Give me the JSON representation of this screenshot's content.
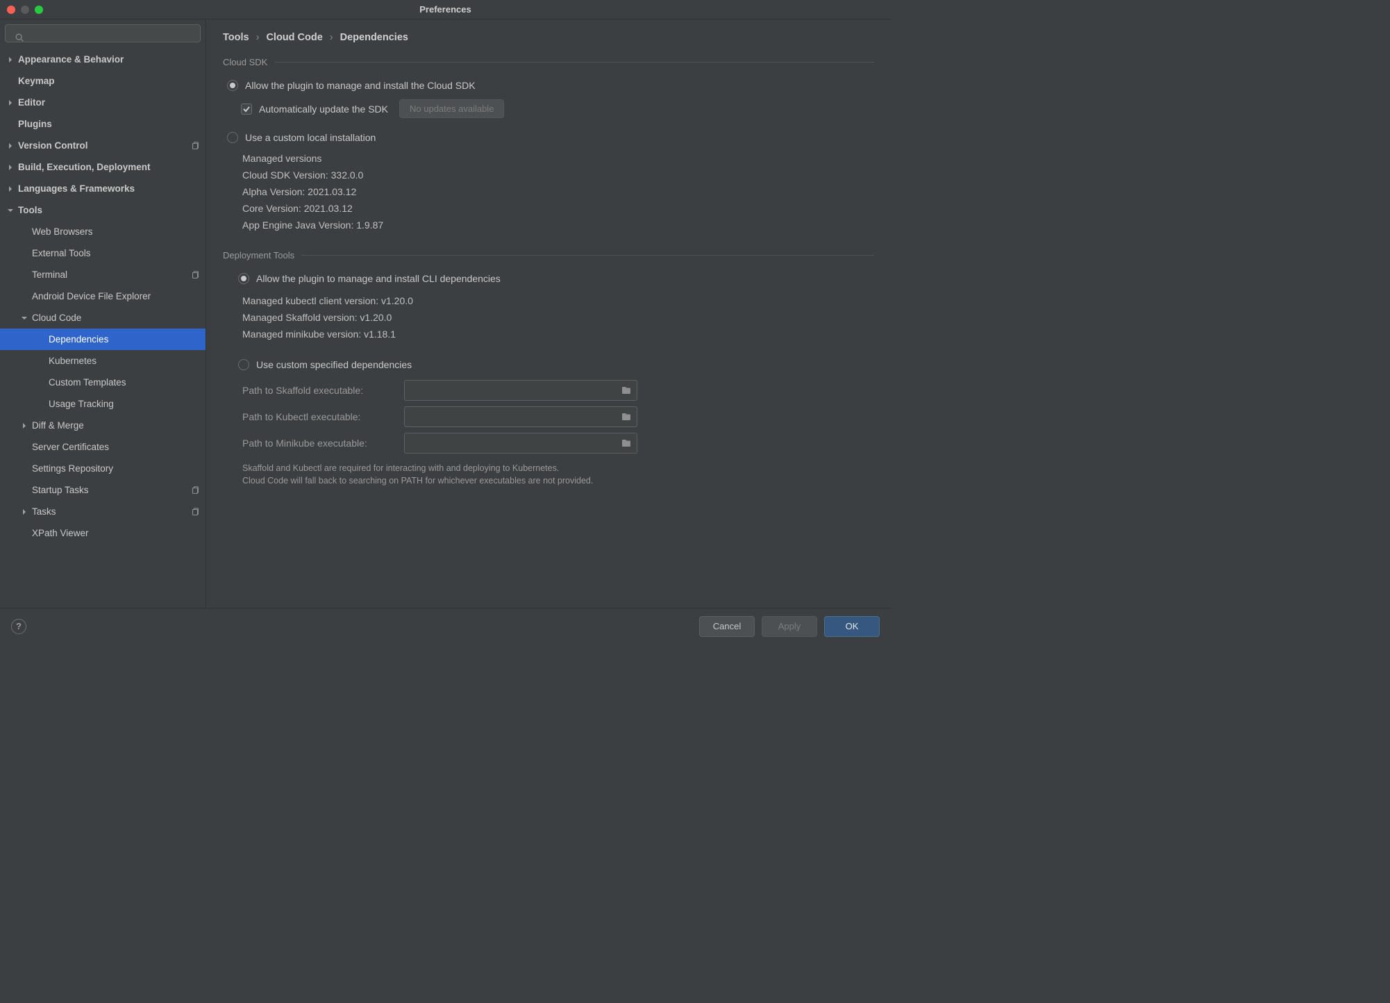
{
  "window": {
    "title": "Preferences"
  },
  "search": {
    "placeholder": ""
  },
  "sidebar": {
    "items": [
      {
        "label": "Appearance & Behavior",
        "top": true,
        "chev": true
      },
      {
        "label": "Keymap",
        "top": true
      },
      {
        "label": "Editor",
        "top": true,
        "chev": true
      },
      {
        "label": "Plugins",
        "top": true
      },
      {
        "label": "Version Control",
        "top": true,
        "chev": true,
        "copy": true
      },
      {
        "label": "Build, Execution, Deployment",
        "top": true,
        "chev": true
      },
      {
        "label": "Languages & Frameworks",
        "top": true,
        "chev": true
      },
      {
        "label": "Tools",
        "top": true,
        "chev": true,
        "expanded": true,
        "children": [
          {
            "label": "Web Browsers"
          },
          {
            "label": "External Tools"
          },
          {
            "label": "Terminal",
            "copy": true
          },
          {
            "label": "Android Device File Explorer"
          },
          {
            "label": "Cloud Code",
            "chev": true,
            "expanded": true,
            "children": [
              {
                "label": "Dependencies",
                "selected": true
              },
              {
                "label": "Kubernetes"
              },
              {
                "label": "Custom Templates"
              },
              {
                "label": "Usage Tracking"
              }
            ]
          },
          {
            "label": "Diff & Merge",
            "chev": true
          },
          {
            "label": "Server Certificates"
          },
          {
            "label": "Settings Repository"
          },
          {
            "label": "Startup Tasks",
            "copy": true
          },
          {
            "label": "Tasks",
            "chev": true,
            "copy": true
          },
          {
            "label": "XPath Viewer"
          }
        ]
      }
    ]
  },
  "breadcrumb": [
    "Tools",
    "Cloud Code",
    "Dependencies"
  ],
  "cloud_sdk": {
    "header": "Cloud SDK",
    "radio_managed": "Allow the plugin to manage and install the Cloud SDK",
    "auto_update": "Automatically update the SDK",
    "no_updates_btn": "No updates available",
    "radio_custom": "Use a custom local installation",
    "managed_versions_title": "Managed versions",
    "lines": [
      "Cloud SDK Version: 332.0.0",
      "Alpha Version: 2021.03.12",
      "Core Version: 2021.03.12",
      "App Engine Java Version: 1.9.87"
    ]
  },
  "deploy": {
    "header": "Deployment Tools",
    "radio_managed": "Allow the plugin to manage and install CLI dependencies",
    "lines": [
      "Managed kubectl client version: v1.20.0",
      "Managed Skaffold version: v1.20.0",
      "Managed minikube version: v1.18.1"
    ],
    "radio_custom": "Use custom specified dependencies",
    "fields": [
      {
        "label": "Path to Skaffold executable:"
      },
      {
        "label": "Path to Kubectl executable:"
      },
      {
        "label": "Path to Minikube executable:"
      }
    ],
    "hint1": "Skaffold and Kubectl are required for interacting with and deploying to Kubernetes.",
    "hint2": "Cloud Code will fall back to searching on PATH for whichever executables are not provided."
  },
  "footer": {
    "cancel": "Cancel",
    "apply": "Apply",
    "ok": "OK"
  }
}
